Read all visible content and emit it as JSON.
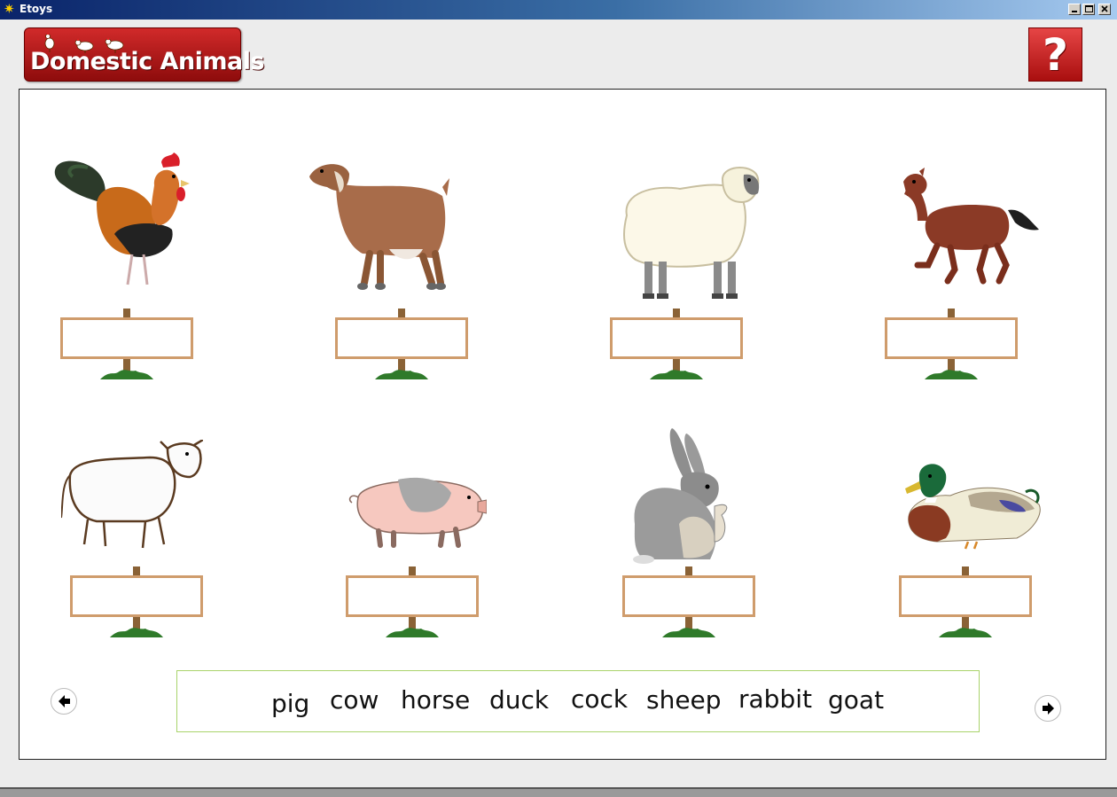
{
  "window": {
    "title": "Etoys",
    "controls": [
      "minimize-icon",
      "maximize-icon",
      "close-icon"
    ]
  },
  "header": {
    "logo_text": "Domestic Animals",
    "help_label": "?"
  },
  "animals": [
    {
      "name": "cock",
      "icon": "rooster-icon"
    },
    {
      "name": "goat",
      "icon": "goat-icon"
    },
    {
      "name": "sheep",
      "icon": "sheep-icon"
    },
    {
      "name": "horse",
      "icon": "horse-icon"
    },
    {
      "name": "cow",
      "icon": "cow-icon"
    },
    {
      "name": "pig",
      "icon": "pig-icon"
    },
    {
      "name": "rabbit",
      "icon": "rabbit-icon"
    },
    {
      "name": "duck",
      "icon": "duck-icon"
    }
  ],
  "answer_slots": [
    "",
    "",
    "",
    "",
    "",
    "",
    "",
    ""
  ],
  "word_bank": [
    "pig",
    "cow",
    "horse",
    "duck",
    "cock",
    "sheep",
    "rabbit",
    "goat"
  ],
  "navigation": {
    "prev_icon": "arrow-left-icon",
    "next_icon": "arrow-right-icon"
  },
  "colors": {
    "logo_red": "#c41e1e",
    "sign_border": "#cf9c6c",
    "wordbank_border": "#a9d36b"
  }
}
